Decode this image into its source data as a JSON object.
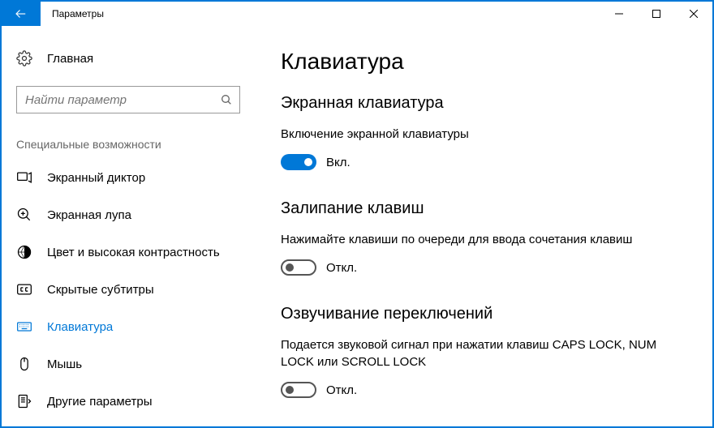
{
  "window": {
    "title": "Параметры"
  },
  "sidebar": {
    "home": "Главная",
    "search_placeholder": "Найти параметр",
    "group_header": "Специальные возможности",
    "items": [
      {
        "label": "Экранный диктор"
      },
      {
        "label": "Экранная лупа"
      },
      {
        "label": "Цвет и высокая контрастность"
      },
      {
        "label": "Скрытые субтитры"
      },
      {
        "label": "Клавиатура"
      },
      {
        "label": "Мышь"
      },
      {
        "label": "Другие параметры"
      }
    ]
  },
  "main": {
    "page_title": "Клавиатура",
    "sections": [
      {
        "title": "Экранная клавиатура",
        "desc": "Включение экранной клавиатуры",
        "toggle_state": "Вкл."
      },
      {
        "title": "Залипание клавиш",
        "desc": "Нажимайте клавиши по очереди для ввода сочетания клавиш",
        "toggle_state": "Откл."
      },
      {
        "title": "Озвучивание переключений",
        "desc": "Подается звуковой сигнал при нажатии клавиш CAPS LOCK, NUM LOCK или SCROLL LOCK",
        "toggle_state": "Откл."
      }
    ]
  }
}
